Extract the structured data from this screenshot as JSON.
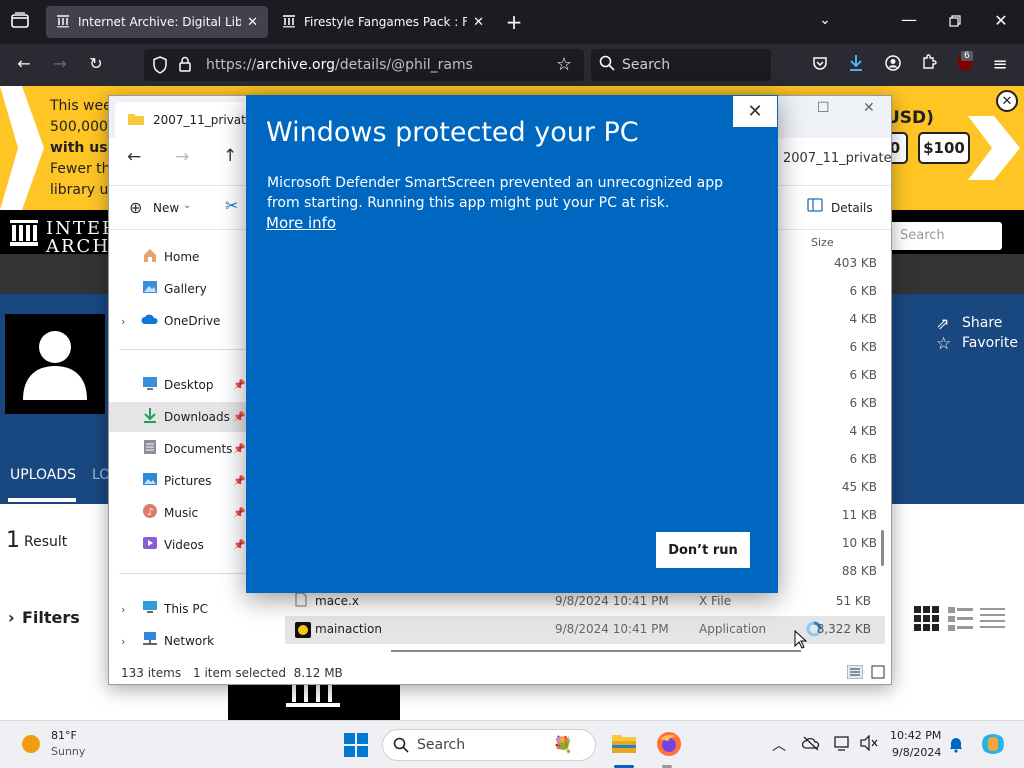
{
  "browser": {
    "tabs": [
      {
        "title": "Internet Archive: Digital Library",
        "active": true
      },
      {
        "title": "Firestyle Fangames Pack : Firest",
        "active": false
      }
    ],
    "url": {
      "prefix": "https://",
      "host": "archive.org",
      "path": "/details/@phil_rams"
    },
    "search_placeholder": "Search",
    "ublock_count": "6"
  },
  "archive_page": {
    "banner_lines": [
      "This week",
      "500,000 l",
      "with us.",
      "Fewer tha",
      "library us"
    ],
    "banner_currency": "USD)",
    "amount_partial": "0",
    "amount_100": "$100",
    "logo_line1": "INTER",
    "logo_line2": "ARCHIV",
    "search_placeholder": "Search",
    "share_label": "Share",
    "favorite_label": "Favorite",
    "tab_uploads": "UPLOADS",
    "tab_partial": "LO",
    "result_count": "1",
    "result_label": "Result",
    "filters_label": "Filters"
  },
  "explorer": {
    "tab_title": "2007_11_private",
    "breadcrumb_last": "2007_11_private",
    "new_label": "New",
    "details_label": "Details",
    "size_header": "Size",
    "nav_items": [
      {
        "label": "Home",
        "icon": "home-icon"
      },
      {
        "label": "Gallery",
        "icon": "gallery-icon"
      },
      {
        "label": "OneDrive",
        "icon": "onedrive-icon"
      },
      {
        "label": "Desktop",
        "icon": "desktop-icon"
      },
      {
        "label": "Downloads",
        "icon": "downloads-icon"
      },
      {
        "label": "Documents",
        "icon": "documents-icon"
      },
      {
        "label": "Pictures",
        "icon": "pictures-icon"
      },
      {
        "label": "Music",
        "icon": "music-icon"
      },
      {
        "label": "Videos",
        "icon": "videos-icon"
      },
      {
        "label": "This PC",
        "icon": "this-pc-icon"
      },
      {
        "label": "Network",
        "icon": "network-icon"
      }
    ],
    "sizes": [
      "403 KB",
      "6 KB",
      "4 KB",
      "6 KB",
      "6 KB",
      "6 KB",
      "4 KB",
      "6 KB",
      "45 KB",
      "11 KB",
      "10 KB",
      "88 KB"
    ],
    "files": [
      {
        "name": "mace.x",
        "date": "9/8/2024 10:41 PM",
        "type": "X File",
        "size": "51 KB"
      },
      {
        "name": "mainaction",
        "date": "9/8/2024 10:41 PM",
        "type": "Application",
        "size": "8,322 KB"
      }
    ],
    "status_items": "133 items",
    "status_selected": "1 item selected  8.12 MB"
  },
  "smartscreen": {
    "title": "Windows protected your PC",
    "message": "Microsoft Defender SmartScreen prevented an unrecognized app from starting. Running this app might put your PC at risk.",
    "more_info": "More info",
    "dont_run": "Don’t run",
    "background_color": "#0067c0"
  },
  "taskbar": {
    "weather_temp": "81°F",
    "weather_desc": "Sunny",
    "search_placeholder": "Search",
    "time": "10:42 PM",
    "date": "9/8/2024"
  }
}
